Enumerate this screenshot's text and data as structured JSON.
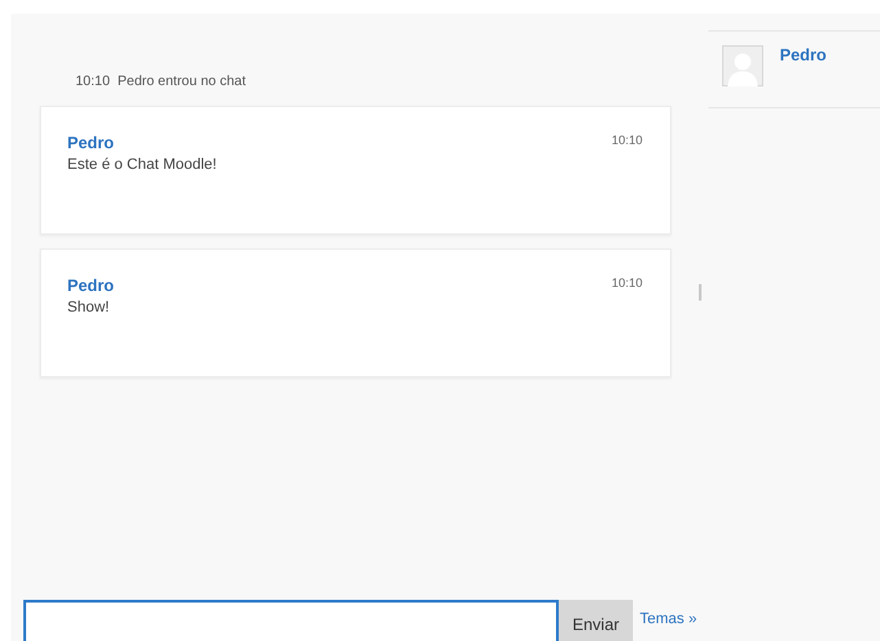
{
  "system_message": {
    "time": "10:10",
    "text": "Pedro entrou no chat"
  },
  "messages": [
    {
      "author": "Pedro",
      "time": "10:10",
      "text": "Este é o Chat Moodle!"
    },
    {
      "author": "Pedro",
      "time": "10:10",
      "text": "Show!"
    }
  ],
  "users": [
    {
      "name": "Pedro"
    }
  ],
  "composer": {
    "button": "Enviar",
    "link": "Temas »"
  }
}
